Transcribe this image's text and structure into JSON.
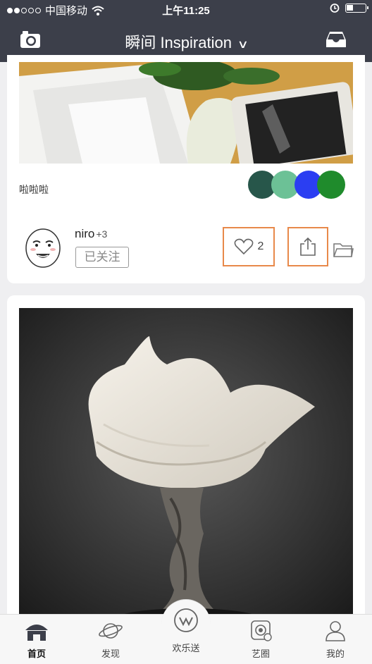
{
  "status_bar": {
    "carrier": "中国移动",
    "time": "上午11:25"
  },
  "nav": {
    "title": "瞬间 Inspiration",
    "left_icon": "camera-icon",
    "right_icon": "inbox-tray-icon"
  },
  "post1": {
    "description": "啦啦啦",
    "colors": [
      "#27564a",
      "#6cc196",
      "#2b3ef2",
      "#1f8b2c"
    ],
    "user": {
      "name": "niro",
      "extra": "+3",
      "follow_label": "已关注"
    },
    "likes": "2",
    "actions": [
      "heart-icon",
      "share-icon",
      "folder-icon"
    ]
  },
  "post2": {
    "image_subject": "white porcelain swirl sculpture on twisted metal stand"
  },
  "tabbar": {
    "items": [
      {
        "label": "首页",
        "icon": "home-icon"
      },
      {
        "label": "发现",
        "icon": "planet-icon"
      },
      {
        "label": "欢乐送",
        "icon": "w-logo-icon"
      },
      {
        "label": "艺圈",
        "icon": "circle-art-icon"
      },
      {
        "label": "我的",
        "icon": "person-icon"
      }
    ]
  }
}
